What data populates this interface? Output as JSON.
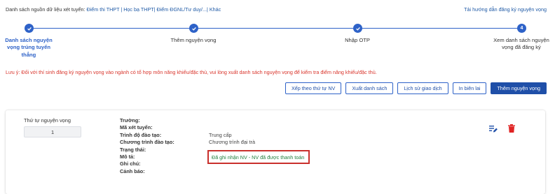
{
  "topbar": {
    "label": "Danh sách nguồn dữ liệu xét tuyển:",
    "sources": "Điểm thi THPT | Học bạ THPT| Điểm ĐGNL/Tư duy/...| Khác",
    "guide_link": "Tải hướng dẫn đăng ký nguyện vọng"
  },
  "stepper": {
    "steps": [
      {
        "number": "",
        "label": "Danh sách nguyện vọng trúng tuyển thẳng"
      },
      {
        "number": "",
        "label": "Thêm nguyện vọng"
      },
      {
        "number": "",
        "label": "Nhập OTP"
      },
      {
        "number": "4",
        "label": "Xem danh sách nguyện vọng đã đăng ký"
      }
    ],
    "accent": "#2e62c8"
  },
  "note": "Lưu ý: Đối với thí sinh đăng ký nguyện vọng vào ngành có tổ hợp môn năng khiếu/đặc thù, vui lòng xuất danh sách nguyện vọng để kiểm tra điểm năng khiếu/đặc thù.",
  "actions": {
    "sort": "Xếp theo thứ tự NV",
    "export": "Xuất danh sách",
    "history": "Lịch sử giao dịch",
    "print": "In biên lai",
    "add": "Thêm nguyện vọng"
  },
  "card": {
    "order_label": "Thứ tự nguyện vọng",
    "order_value": "1",
    "fields": [
      {
        "key": "Trường:",
        "value": ""
      },
      {
        "key": "Mã xét tuyển:",
        "value": ""
      },
      {
        "key": "Trình độ đào tạo:",
        "value": "Trung cấp"
      },
      {
        "key": "Chương trình đào tạo:",
        "value": "Chương trình đại trà"
      },
      {
        "key": "Trạng thái:",
        "value": ""
      },
      {
        "key": "Mô tả:",
        "value": ""
      },
      {
        "key": "Ghi chú:",
        "value": ""
      },
      {
        "key": "Cảnh báo:",
        "value": ""
      }
    ],
    "status": "Đã ghi nhận NV - NV đã được thanh toán",
    "icons": {
      "edit": "list-edit-icon",
      "delete": "trash-icon"
    },
    "colors": {
      "status": "#1e7d3a",
      "highlight": "#c9302c",
      "delete": "#e02424"
    }
  }
}
